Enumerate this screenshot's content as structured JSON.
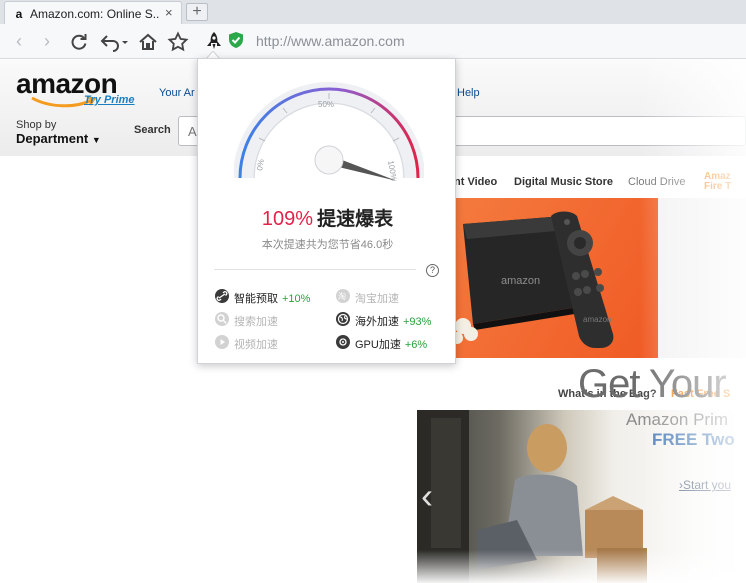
{
  "browser": {
    "tab_title": "Amazon.com: Online S...",
    "tab_favicon": "a",
    "tab_close": "×",
    "new_tab": "+",
    "url": "http://www.amazon.com",
    "icons": [
      "back-icon",
      "forward-icon",
      "reload-icon",
      "undo-icon",
      "home-icon",
      "star-icon",
      "rocket-icon",
      "shield-check-icon"
    ]
  },
  "amazon": {
    "logo": "amazon",
    "try_prime": "Try Prime",
    "your_account": "Your Ar",
    "help": "Help",
    "shop_by": "Shop by",
    "department": "Department",
    "search_label": "Search",
    "search_placeholder": "A",
    "nav_items": [
      "nt Video",
      "Digital Music Store",
      "Cloud Drive",
      "Amaz Fire T"
    ],
    "whats_in_bag": "What's in the Bag?",
    "fast_free": "Fast Free S",
    "hero_title": "Get Your",
    "hero_prime": "Amazon Prim",
    "hero_free": "FREE Two",
    "hero_cta": "›Start you"
  },
  "accelerator": {
    "gauge_labels": [
      "0%",
      "50%",
      "100%"
    ],
    "speed_percent": "109%",
    "speed_text": "提速爆表",
    "saved_text": "本次提速共为您节省46.0秒",
    "help": "?",
    "features": [
      {
        "label": "智能预取",
        "value": "+10%",
        "active": true
      },
      {
        "label": "淘宝加速",
        "value": "",
        "active": false
      },
      {
        "label": "搜索加速",
        "value": "",
        "active": false
      },
      {
        "label": "海外加速",
        "value": "+93%",
        "active": true
      },
      {
        "label": "视频加速",
        "value": "",
        "active": false
      },
      {
        "label": "GPU加速",
        "value": "+6%",
        "active": true
      }
    ],
    "colors": {
      "accent": "#e0244a",
      "positive": "#2aa13a",
      "gauge_start": "#3b82e6",
      "gauge_end": "#e0244a"
    }
  }
}
